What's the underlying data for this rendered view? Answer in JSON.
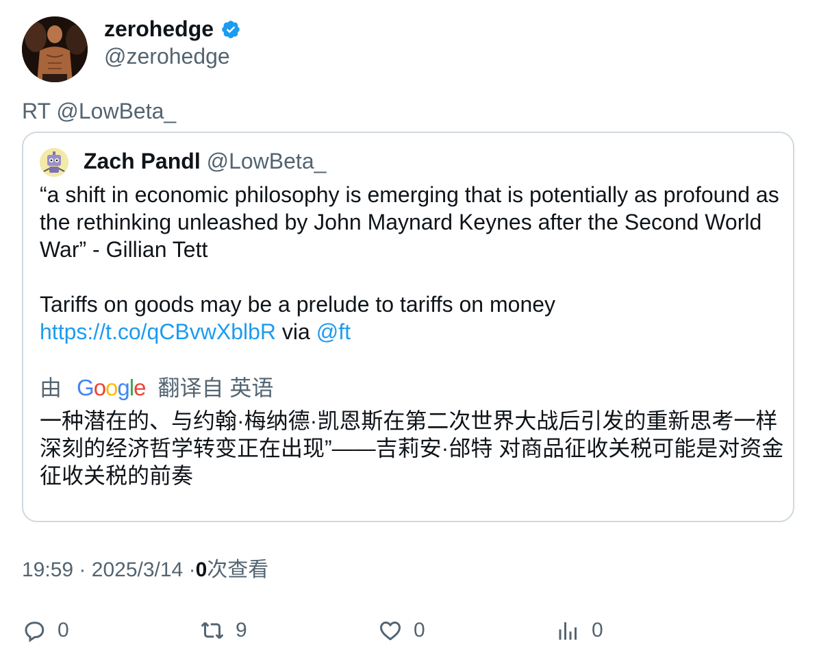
{
  "author": {
    "name": "zerohedge",
    "handle": "@zerohedge",
    "verified_icon": "verified-badge-icon",
    "verified_color": "#1d9bf0"
  },
  "retweet_text": "RT @LowBeta_",
  "quote": {
    "name": "Zach Pandl",
    "handle": "@LowBeta_",
    "paragraph1": "“a shift in economic philosophy is emerging that is potentially as profound as the rethinking unleashed by John Maynard Keynes after the Second World War” - Gillian Tett",
    "paragraph2_text": "Tariffs on goods may be a prelude to tariffs on money",
    "link": "https://t.co/qCBvwXblbR",
    "via": "via",
    "mention": "@ft",
    "translate_prefix": "由",
    "translate_logo": "Google",
    "translate_suffix": "翻译自 英语",
    "translation": "一种潜在的、与约翰·梅纳德·凯恩斯在第二次世界大战后引发的重新思考一样深刻的经济哲学转变正在出现”——吉莉安·邰特 对商品征收关税可能是对资金征收关税的前奏"
  },
  "meta": {
    "time": "19:59",
    "separator": "·",
    "date": "2025/3/14",
    "views_count": "0",
    "views_label": "次查看"
  },
  "actions": {
    "reply": {
      "icon": "reply-icon",
      "count": "0"
    },
    "retweet": {
      "icon": "retweet-icon",
      "count": "9"
    },
    "like": {
      "icon": "heart-icon",
      "count": "0"
    },
    "views": {
      "icon": "analytics-icon",
      "count": "0"
    }
  },
  "colors": {
    "link": "#1d9bf0",
    "secondary_text": "#536471",
    "primary_text": "#0f1419",
    "border": "#cfd9de"
  }
}
